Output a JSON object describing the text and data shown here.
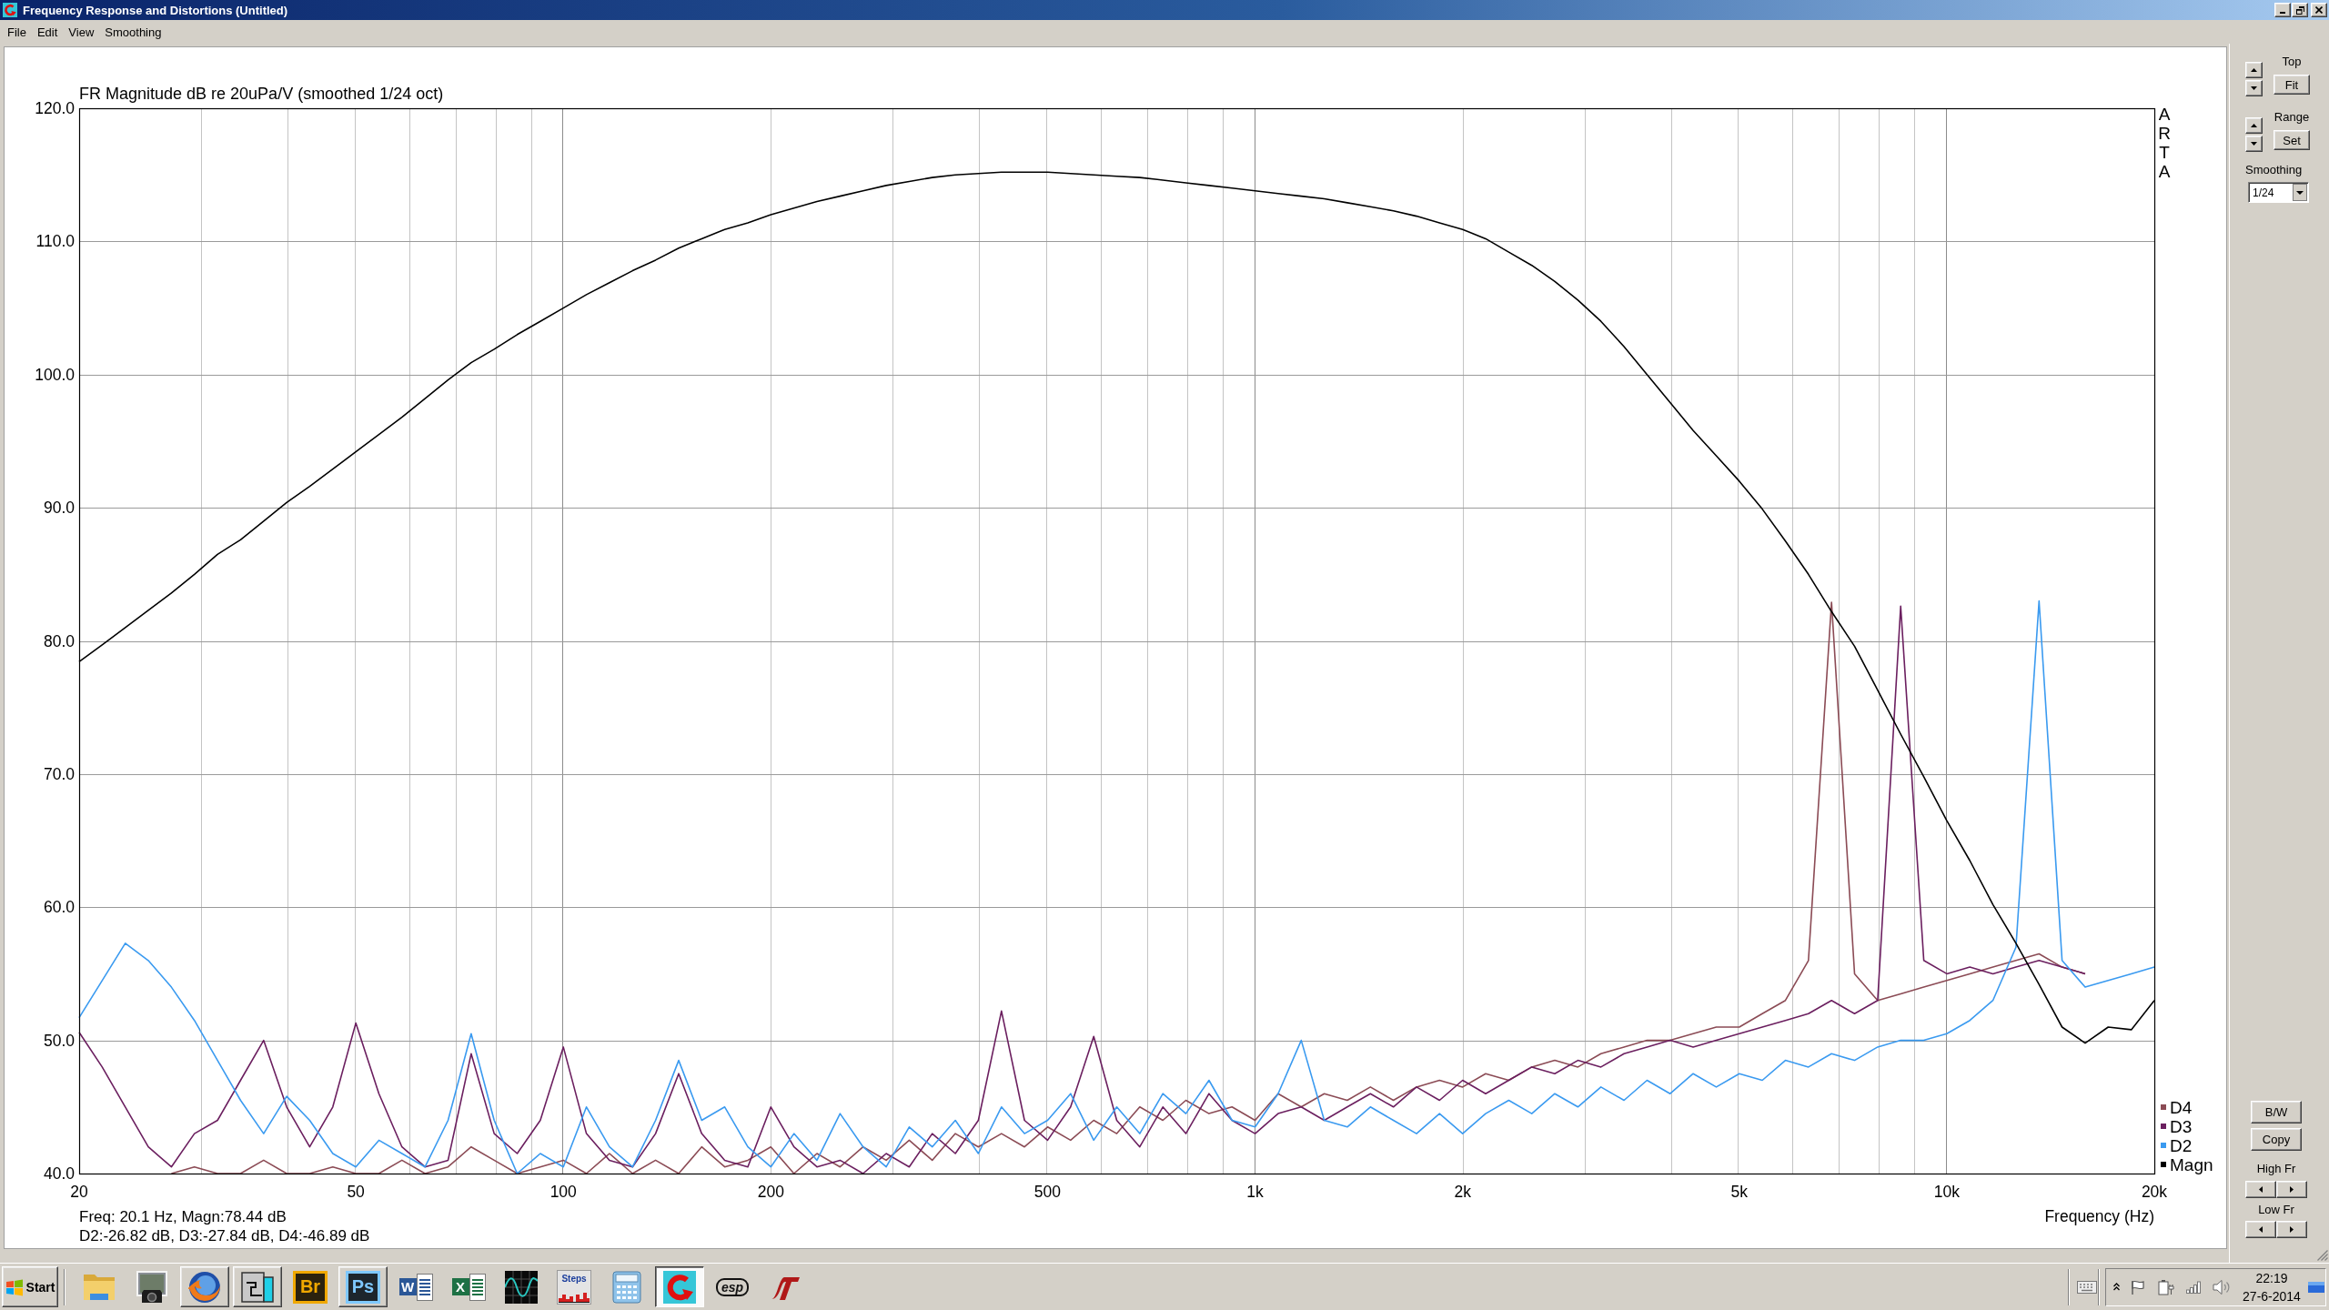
{
  "window": {
    "title": "Frequency Response and Distortions (Untitled)"
  },
  "menu": [
    {
      "label": "File"
    },
    {
      "label": "Edit"
    },
    {
      "label": "View"
    },
    {
      "label": "Smoothing"
    }
  ],
  "plot": {
    "chart_data": {
      "type": "line",
      "title": "FR Magnitude dB re 20uPa/V (smoothed 1/24 oct)",
      "xlabel": "Frequency (Hz)",
      "grid": true,
      "legend": "right",
      "categories": [
        "20",
        null,
        null,
        null,
        null,
        null,
        null,
        null,
        null,
        null,
        null,
        null,
        "50",
        null,
        null,
        null,
        null,
        null,
        null,
        null,
        null,
        "100",
        null,
        null,
        null,
        null,
        null,
        null,
        null,
        null,
        "200",
        null,
        null,
        null,
        null,
        null,
        null,
        null,
        null,
        null,
        null,
        null,
        "500",
        null,
        null,
        null,
        null,
        null,
        null,
        null,
        null,
        "1k",
        null,
        null,
        null,
        null,
        null,
        null,
        null,
        null,
        "2k",
        null,
        null,
        null,
        null,
        null,
        null,
        null,
        null,
        null,
        null,
        null,
        "5k",
        null,
        null,
        null,
        null,
        null,
        null,
        null,
        null,
        "10k",
        null,
        null,
        null,
        null,
        null,
        null,
        null,
        null,
        "20k"
      ],
      "series": [
        {
          "name": "D4",
          "color": "#8b4b55",
          "values": [
            null,
            null,
            null,
            null,
            40.0,
            40.5,
            40.0,
            40.0,
            41.0,
            40.0,
            40.0,
            40.5,
            40.0,
            40.0,
            41.0,
            40.0,
            40.5,
            42.0,
            41.0,
            40.0,
            40.5,
            41.0,
            40.0,
            41.5,
            40.0,
            41.0,
            40.0,
            42.0,
            40.5,
            41.0,
            42.0,
            40.0,
            41.5,
            40.5,
            42.0,
            41.0,
            42.5,
            41.0,
            43.0,
            42.0,
            43.0,
            42.0,
            43.5,
            42.5,
            44.0,
            43.0,
            45.0,
            44.0,
            45.5,
            44.5,
            45.0,
            44.0,
            46.0,
            45.0,
            46.0,
            45.5,
            46.5,
            45.5,
            46.5,
            47.0,
            46.5,
            47.5,
            47.0,
            48.0,
            48.5,
            48.0,
            49.0,
            49.5,
            50.0,
            50.0,
            50.5,
            51.0,
            51.0,
            52.0,
            53.0,
            56.0,
            82.9,
            55.0,
            53.0,
            53.5,
            54.0,
            54.5,
            55.0,
            55.5,
            56.0,
            56.5,
            55.5,
            55.0,
            null,
            null,
            null
          ]
        },
        {
          "name": "D3",
          "color": "#6b1f5f",
          "values": [
            50.6,
            48.0,
            45.0,
            42.0,
            40.5,
            43.0,
            44.0,
            47.0,
            50.0,
            45.0,
            42.0,
            45.0,
            51.3,
            46.0,
            42.0,
            40.5,
            41.0,
            49.0,
            43.0,
            41.5,
            44.0,
            49.5,
            43.0,
            41.0,
            40.5,
            43.0,
            47.5,
            43.0,
            41.0,
            40.5,
            45.0,
            42.0,
            40.5,
            41.0,
            40.0,
            41.5,
            40.5,
            43.0,
            41.5,
            44.0,
            52.2,
            44.0,
            42.5,
            45.0,
            50.3,
            44.0,
            42.0,
            45.0,
            43.0,
            46.0,
            44.0,
            43.0,
            44.5,
            45.0,
            44.0,
            45.0,
            46.0,
            45.0,
            46.5,
            45.5,
            47.0,
            46.0,
            47.0,
            48.0,
            47.5,
            48.5,
            48.0,
            49.0,
            49.5,
            50.0,
            49.5,
            50.0,
            50.5,
            51.0,
            51.5,
            52.0,
            53.0,
            52.0,
            53.0,
            82.6,
            56.0,
            55.0,
            55.5,
            55.0,
            55.5,
            56.0,
            55.5,
            55.0,
            null,
            null,
            null
          ]
        },
        {
          "name": "D2",
          "color": "#3a9af0",
          "values": [
            51.7,
            54.5,
            57.3,
            56.0,
            54.0,
            51.5,
            48.5,
            45.5,
            43.0,
            45.8,
            44.0,
            41.5,
            40.5,
            42.5,
            41.5,
            40.5,
            44.0,
            50.5,
            44.0,
            40.0,
            41.5,
            40.5,
            45.0,
            42.0,
            40.5,
            44.0,
            48.5,
            44.0,
            45.0,
            42.0,
            40.5,
            43.0,
            41.0,
            44.5,
            42.0,
            40.5,
            43.5,
            42.0,
            44.0,
            41.5,
            45.0,
            43.0,
            44.0,
            46.0,
            42.5,
            45.0,
            43.0,
            46.0,
            44.5,
            47.0,
            44.0,
            43.5,
            46.0,
            50.0,
            44.0,
            43.5,
            45.0,
            44.0,
            43.0,
            44.5,
            43.0,
            44.5,
            45.5,
            44.5,
            46.0,
            45.0,
            46.5,
            45.5,
            47.0,
            46.0,
            47.5,
            46.5,
            47.5,
            47.0,
            48.5,
            48.0,
            49.0,
            48.5,
            49.5,
            50.0,
            50.0,
            50.5,
            51.5,
            53.0,
            57.0,
            83.0,
            56.0,
            54.0,
            54.5,
            55.0,
            55.5
          ]
        },
        {
          "name": "Magn",
          "color": "#000000",
          "values": [
            78.44,
            79.7,
            81.0,
            82.3,
            83.6,
            85.0,
            86.5,
            87.6,
            89.0,
            90.4,
            91.6,
            92.9,
            94.2,
            95.5,
            96.8,
            98.2,
            99.6,
            100.9,
            101.9,
            103.0,
            104.0,
            105.0,
            106.0,
            106.9,
            107.8,
            108.6,
            109.5,
            110.2,
            110.9,
            111.4,
            112.0,
            112.5,
            113.0,
            113.4,
            113.8,
            114.2,
            114.5,
            114.8,
            115.0,
            115.1,
            115.2,
            115.2,
            115.2,
            115.1,
            115.0,
            114.9,
            114.8,
            114.6,
            114.4,
            114.2,
            114.0,
            113.8,
            113.6,
            113.4,
            113.2,
            112.9,
            112.6,
            112.3,
            111.9,
            111.4,
            110.9,
            110.2,
            109.2,
            108.2,
            107.0,
            105.6,
            104.0,
            102.1,
            100.0,
            97.9,
            95.8,
            93.9,
            92.0,
            89.9,
            87.5,
            85.0,
            82.2,
            79.6,
            76.3,
            73.0,
            69.8,
            66.5,
            63.5,
            60.2,
            57.3,
            54.2,
            51.0,
            49.8,
            51.0,
            50.8,
            53.0
          ]
        }
      ],
      "ylim": [
        40,
        120
      ],
      "yticks": [
        {
          "value": 40,
          "label": "40.0"
        },
        {
          "value": 50,
          "label": "50.0"
        },
        {
          "value": 60,
          "label": "60.0"
        },
        {
          "value": 70,
          "label": "70.0"
        },
        {
          "value": 80,
          "label": "80.0"
        },
        {
          "value": 90,
          "label": "90.0"
        },
        {
          "value": 100,
          "label": "100.0"
        },
        {
          "value": 110,
          "label": "110.0"
        },
        {
          "value": 120,
          "label": "120.0"
        }
      ]
    },
    "side_label": "ARTA",
    "readout": [
      "Freq: 20.1 Hz, Magn:78.44 dB",
      "D2:-26.82 dB, D3:-27.84 dB, D4:-46.89 dB"
    ]
  },
  "side_panel": {
    "top": {
      "label": "Top",
      "button": "Fit"
    },
    "range": {
      "label": "Range",
      "button": "Set"
    },
    "smoothing": {
      "label": "Smoothing",
      "value": "1/24"
    },
    "buttons": [
      "B/W",
      "Copy"
    ],
    "high_fr": {
      "label": "High Fr"
    },
    "low_fr": {
      "label": "Low Fr"
    }
  },
  "taskbar": {
    "start": "Start",
    "items": [
      {
        "kind": "folder",
        "running": false,
        "selected": false
      },
      {
        "kind": "camera",
        "running": false,
        "selected": false
      },
      {
        "kind": "globe",
        "running": true,
        "selected": false
      },
      {
        "kind": "window",
        "running": true,
        "selected": false
      },
      {
        "kind": "tile",
        "label": "Br",
        "color": "#f0a800",
        "running": false,
        "selected": false
      },
      {
        "kind": "tile",
        "label": "Ps",
        "color": "#7ec8ff",
        "running": true,
        "selected": false
      },
      {
        "kind": "doc",
        "label": "W",
        "color": "#2b5797",
        "running": false,
        "selected": false
      },
      {
        "kind": "doc",
        "label": "X",
        "color": "#1e7145",
        "running": false,
        "selected": false
      },
      {
        "kind": "scope",
        "running": false,
        "selected": false
      },
      {
        "kind": "steps",
        "label": "Steps",
        "running": false,
        "selected": false
      },
      {
        "kind": "calculator",
        "running": false,
        "selected": false
      },
      {
        "kind": "arrow",
        "running": true,
        "selected": true
      },
      {
        "kind": "badge",
        "label": "esp",
        "running": false,
        "selected": false
      },
      {
        "kind": "logo",
        "running": false,
        "selected": false
      }
    ],
    "clock": {
      "time": "22:19",
      "date": "27-6-2014"
    }
  }
}
